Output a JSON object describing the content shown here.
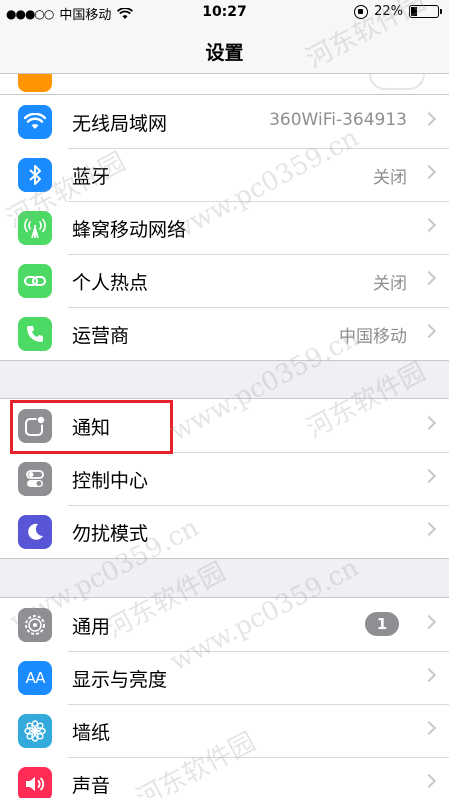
{
  "status_bar": {
    "signal": "●●●○○",
    "carrier": "中国移动",
    "time": "10:27",
    "battery_percent": "22%",
    "battery_level": 0.22
  },
  "nav": {
    "title": "设置"
  },
  "group1": [
    {
      "label": "无线局域网",
      "value": "360WiFi-364913",
      "icon": "wifi-icon",
      "color": "#1a8cff"
    },
    {
      "label": "蓝牙",
      "value": "关闭",
      "icon": "bluetooth-icon",
      "color": "#1a8cff"
    },
    {
      "label": "蜂窝移动网络",
      "value": "",
      "icon": "cellular-icon",
      "color": "#4cd964"
    },
    {
      "label": "个人热点",
      "value": "关闭",
      "icon": "hotspot-icon",
      "color": "#4cd964"
    },
    {
      "label": "运营商",
      "value": "中国移动",
      "icon": "phone-icon",
      "color": "#4cd964"
    }
  ],
  "group2": [
    {
      "label": "通知",
      "icon": "notifications-icon",
      "color": "#8e8e93"
    },
    {
      "label": "控制中心",
      "icon": "control-center-icon",
      "color": "#8e8e93"
    },
    {
      "label": "勿扰模式",
      "icon": "moon-icon",
      "color": "#5856d6"
    }
  ],
  "group3": [
    {
      "label": "通用",
      "badge": "1",
      "icon": "gear-icon",
      "color": "#8e8e93"
    },
    {
      "label": "显示与亮度",
      "icon": "display-icon",
      "icon_text": "AA",
      "color": "#1a8cff"
    },
    {
      "label": "墙纸",
      "icon": "wallpaper-icon",
      "color": "#34aadc"
    },
    {
      "label": "声音",
      "icon": "sound-icon",
      "color": "#ff2d55"
    }
  ],
  "watermarks": [
    "河东软件园",
    "www.pc0359.cn"
  ]
}
